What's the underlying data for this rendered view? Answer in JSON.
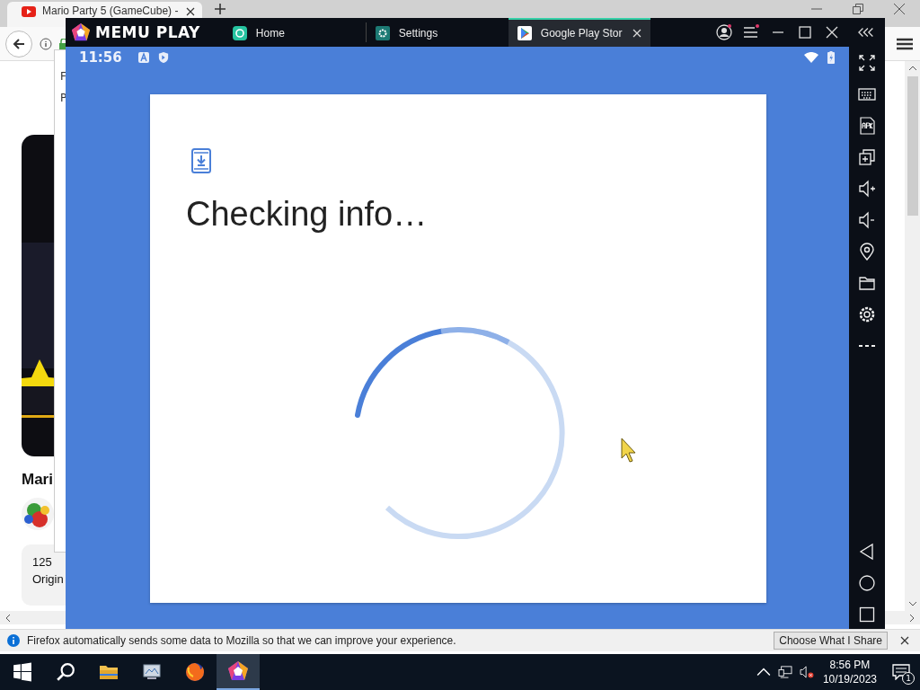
{
  "browser": {
    "tab": {
      "title": "Mario Party 5 (GameCube) -"
    },
    "popup": {
      "lines": [
        "F",
        "P"
      ]
    },
    "page": {
      "title": "Mari",
      "stat": "125",
      "stat_label": "Origin"
    },
    "notification": {
      "text": "Firefox automatically sends some data to Mozilla so that we can improve your experience.",
      "button": "Choose What I Share"
    }
  },
  "emulator": {
    "brand": "MEMU PLAY",
    "tabs": [
      {
        "label": "Home",
        "kind": "home",
        "selected": false
      },
      {
        "label": "Settings",
        "kind": "settings",
        "selected": false
      },
      {
        "label": "Google Play Stor",
        "kind": "play",
        "selected": true
      }
    ],
    "status": {
      "time": "11:56"
    },
    "dialog": {
      "title": "Checking info…"
    }
  },
  "taskbar": {
    "time": "8:56 PM",
    "date": "10/19/2023",
    "notifications": "1"
  }
}
